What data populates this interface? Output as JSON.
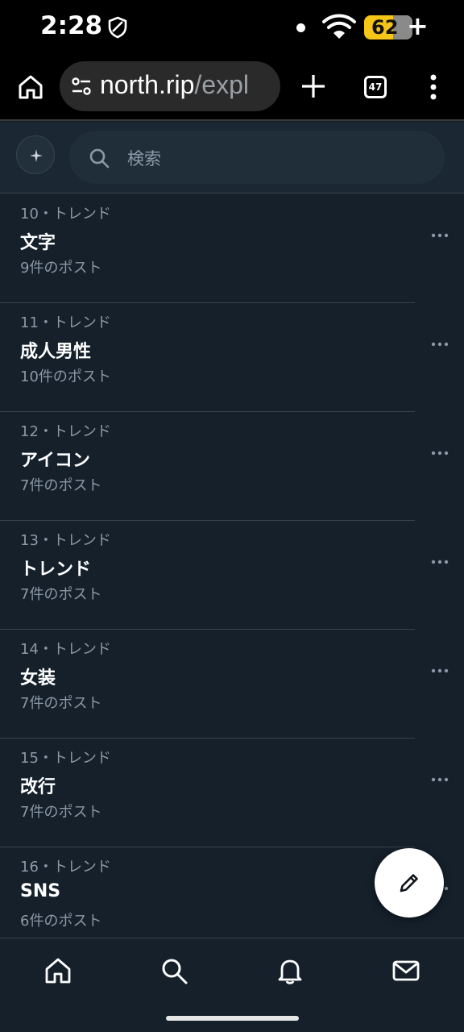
{
  "status_bar": {
    "time": "2:28",
    "battery_level": "62",
    "icons": [
      "shield-icon",
      "notification-dot",
      "wifi-icon",
      "battery-icon",
      "charging-plus-icon"
    ]
  },
  "browser": {
    "url_main": "north.rip",
    "url_path": "/expl",
    "tab_count": "47",
    "icons": [
      "home-icon",
      "site-settings-icon",
      "new-tab-icon",
      "tabs-icon",
      "menu-icon"
    ]
  },
  "search": {
    "placeholder": "検索",
    "icons": [
      "sparkle-icon",
      "search-icon"
    ]
  },
  "trends": [
    {
      "meta": "10・トレンド",
      "name": "文字",
      "count": "9件のポスト"
    },
    {
      "meta": "11・トレンド",
      "name": "成人男性",
      "count": "10件のポスト"
    },
    {
      "meta": "12・トレンド",
      "name": "アイコン",
      "count": "7件のポスト"
    },
    {
      "meta": "13・トレンド",
      "name": "トレンド",
      "count": "7件のポスト"
    },
    {
      "meta": "14・トレンド",
      "name": "女装",
      "count": "7件のポスト"
    },
    {
      "meta": "15・トレンド",
      "name": "改行",
      "count": "7件のポスト"
    },
    {
      "meta": "16・トレンド",
      "name": "SNS",
      "count": "6件のポスト"
    }
  ],
  "bottom_nav": {
    "items": [
      "home-icon",
      "search-icon",
      "bell-icon",
      "mail-icon"
    ]
  },
  "colors": {
    "background": "#15202b",
    "divider": "#38444d",
    "secondary_text": "#8b98a5",
    "battery": "#f5c518"
  }
}
